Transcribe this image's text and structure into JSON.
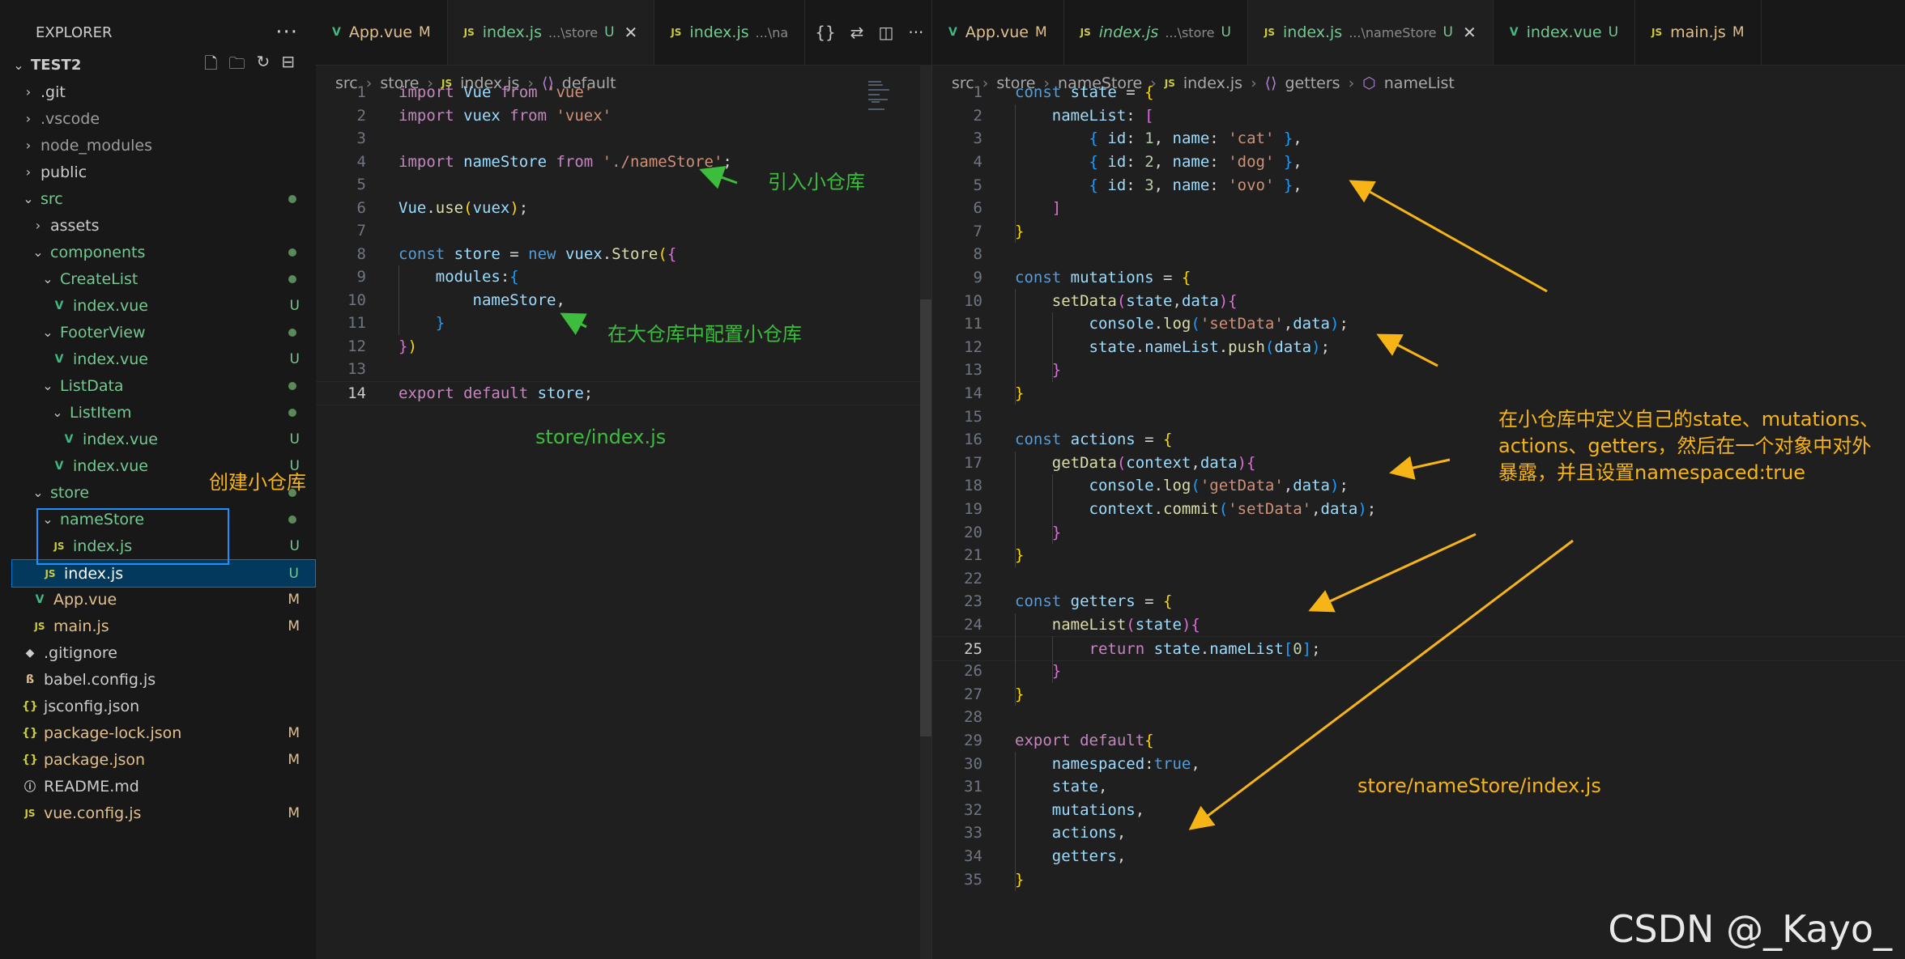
{
  "sidebar": {
    "title": "EXPLORER",
    "more": "···",
    "root": "TEST2",
    "items": [
      {
        "label": ".git",
        "kind": "folder",
        "level": 1,
        "open": false,
        "color": "#cccccc"
      },
      {
        "label": ".vscode",
        "kind": "folder",
        "level": 1,
        "open": false,
        "color": "#9d9d9d"
      },
      {
        "label": "node_modules",
        "kind": "folder",
        "level": 1,
        "open": false,
        "color": "#9d9d9d"
      },
      {
        "label": "public",
        "kind": "folder",
        "level": 1,
        "open": false,
        "color": "#cccccc"
      },
      {
        "label": "src",
        "kind": "folder",
        "level": 1,
        "open": true,
        "color": "#73c991",
        "dot": true
      },
      {
        "label": "assets",
        "kind": "folder",
        "level": 2,
        "open": false,
        "color": "#cccccc"
      },
      {
        "label": "components",
        "kind": "folder",
        "level": 2,
        "open": true,
        "color": "#73c991",
        "dot": true
      },
      {
        "label": "CreateList",
        "kind": "folder",
        "level": 3,
        "open": true,
        "color": "#73c991",
        "dot": true
      },
      {
        "label": "index.vue",
        "kind": "vue",
        "level": 4,
        "color": "#73c991",
        "status": "U"
      },
      {
        "label": "FooterView",
        "kind": "folder",
        "level": 3,
        "open": true,
        "color": "#73c991",
        "dot": true
      },
      {
        "label": "index.vue",
        "kind": "vue",
        "level": 4,
        "color": "#73c991",
        "status": "U"
      },
      {
        "label": "ListData",
        "kind": "folder",
        "level": 3,
        "open": true,
        "color": "#73c991",
        "dot": true
      },
      {
        "label": "ListItem",
        "kind": "folder",
        "level": 4,
        "open": true,
        "color": "#73c991",
        "dot": true
      },
      {
        "label": "index.vue",
        "kind": "vue",
        "level": 5,
        "color": "#73c991",
        "status": "U"
      },
      {
        "label": "index.vue",
        "kind": "vue",
        "level": 4,
        "color": "#73c991",
        "status": "U"
      },
      {
        "label": "store",
        "kind": "folder",
        "level": 2,
        "open": true,
        "color": "#73c991",
        "dot": true
      },
      {
        "label": "nameStore",
        "kind": "folder",
        "level": 3,
        "open": true,
        "color": "#73c991",
        "dot": true
      },
      {
        "label": "index.js",
        "kind": "js",
        "level": 4,
        "color": "#73c991",
        "status": "U"
      },
      {
        "label": "index.js",
        "kind": "js",
        "level": 3,
        "color": "#73c991",
        "status": "U",
        "selected": true
      },
      {
        "label": "App.vue",
        "kind": "vue",
        "level": 2,
        "color": "#e2c08d",
        "status": "M"
      },
      {
        "label": "main.js",
        "kind": "js",
        "level": 2,
        "color": "#e2c08d",
        "status": "M"
      },
      {
        "label": ".gitignore",
        "kind": "git",
        "level": 1,
        "color": "#cccccc"
      },
      {
        "label": "babel.config.js",
        "kind": "babel",
        "level": 1,
        "color": "#cccccc"
      },
      {
        "label": "jsconfig.json",
        "kind": "json",
        "level": 1,
        "color": "#cccccc"
      },
      {
        "label": "package-lock.json",
        "kind": "json",
        "level": 1,
        "color": "#e2c08d",
        "status": "M"
      },
      {
        "label": "package.json",
        "kind": "json",
        "level": 1,
        "color": "#e2c08d",
        "status": "M"
      },
      {
        "label": "README.md",
        "kind": "info",
        "level": 1,
        "color": "#cccccc"
      },
      {
        "label": "vue.config.js",
        "kind": "js",
        "level": 1,
        "color": "#e2c08d",
        "status": "M"
      }
    ]
  },
  "editor1": {
    "tabs": [
      {
        "label": "App.vue",
        "status": "M",
        "kind": "vue",
        "color": "#e2c08d"
      },
      {
        "label": "index.js",
        "desc": "...\\store",
        "status": "U",
        "kind": "js",
        "color": "#73c991",
        "active": true,
        "close": "✕"
      },
      {
        "label": "index.js",
        "desc": "...\\na",
        "kind": "js",
        "color": "#73c991"
      }
    ],
    "tools": [
      "{}",
      "⇄",
      "◫",
      "···"
    ],
    "breadcrumbs": [
      "src",
      "store",
      "index.js",
      "default"
    ],
    "current_line": 14,
    "lines": [
      [
        [
          "kw2",
          "import "
        ],
        [
          "id",
          "Vue "
        ],
        [
          "kw2",
          "from "
        ],
        [
          "str",
          "'vue'"
        ]
      ],
      [
        [
          "kw2",
          "import "
        ],
        [
          "id",
          "vuex "
        ],
        [
          "kw2",
          "from "
        ],
        [
          "str",
          "'vuex'"
        ]
      ],
      [],
      [
        [
          "kw2",
          "import "
        ],
        [
          "id",
          "nameStore "
        ],
        [
          "kw2",
          "from "
        ],
        [
          "str",
          "'./nameStore'"
        ],
        [
          "pun",
          ";"
        ]
      ],
      [],
      [
        [
          "id",
          "Vue"
        ],
        [
          "pun",
          "."
        ],
        [
          "fn",
          "use"
        ],
        [
          "br1",
          "("
        ],
        [
          "id",
          "vuex"
        ],
        [
          "br1",
          ")"
        ],
        [
          "pun",
          ";"
        ]
      ],
      [],
      [
        [
          "kw",
          "const "
        ],
        [
          "id",
          "store "
        ],
        [
          "pun",
          "= "
        ],
        [
          "kw",
          "new "
        ],
        [
          "id",
          "vuex"
        ],
        [
          "pun",
          "."
        ],
        [
          "fn",
          "Store"
        ],
        [
          "br1",
          "("
        ],
        [
          "br2",
          "{"
        ]
      ],
      [
        [
          "pun",
          "    "
        ],
        [
          "id",
          "modules"
        ],
        [
          "pun",
          ":"
        ],
        [
          "br3",
          "{"
        ]
      ],
      [
        [
          "pun",
          "        "
        ],
        [
          "id",
          "nameStore"
        ],
        [
          "pun",
          ","
        ]
      ],
      [
        [
          "pun",
          "    "
        ],
        [
          "br3",
          "}"
        ]
      ],
      [
        [
          "br2",
          "}"
        ],
        [
          "br1",
          ")"
        ]
      ],
      [],
      [
        [
          "kw2",
          "export "
        ],
        [
          "kw2",
          "default "
        ],
        [
          "id",
          "store"
        ],
        [
          "pun",
          ";"
        ]
      ]
    ],
    "annotations": [
      {
        "text": "引入小仓库",
        "color": "green"
      },
      {
        "text": "在大仓库中配置小仓库",
        "color": "green"
      },
      {
        "text": "store/index.js",
        "color": "green"
      }
    ]
  },
  "sidebar_annotation": "创建小仓库",
  "editor2": {
    "tabs": [
      {
        "label": "App.vue",
        "status": "M",
        "kind": "vue",
        "color": "#e2c08d"
      },
      {
        "label": "index.js",
        "desc": "...\\store",
        "status": "U",
        "kind": "js",
        "color": "#73c991",
        "italic": true
      },
      {
        "label": "index.js",
        "desc": "...\\nameStore",
        "status": "U",
        "kind": "js",
        "color": "#73c991",
        "active": true,
        "close": "✕"
      },
      {
        "label": "index.vue",
        "status": "U",
        "kind": "vue",
        "color": "#73c991"
      },
      {
        "label": "main.js",
        "status": "M",
        "kind": "js",
        "color": "#e2c08d"
      }
    ],
    "breadcrumbs": [
      "src",
      "store",
      "nameStore",
      "index.js",
      "getters",
      "nameList"
    ],
    "current_line": 25,
    "lines": [
      [
        [
          "kw",
          "const "
        ],
        [
          "id",
          "state "
        ],
        [
          "pun",
          "= "
        ],
        [
          "br1",
          "{"
        ]
      ],
      [
        [
          "pun",
          "    "
        ],
        [
          "id",
          "nameList"
        ],
        [
          "pun",
          ": "
        ],
        [
          "br2",
          "["
        ]
      ],
      [
        [
          "pun",
          "        "
        ],
        [
          "br3",
          "{ "
        ],
        [
          "id",
          "id"
        ],
        [
          "pun",
          ": "
        ],
        [
          "num",
          "1"
        ],
        [
          "pun",
          ", "
        ],
        [
          "id",
          "name"
        ],
        [
          "pun",
          ": "
        ],
        [
          "str",
          "'cat'"
        ],
        [
          "br3",
          " }"
        ],
        [
          "pun",
          ","
        ]
      ],
      [
        [
          "pun",
          "        "
        ],
        [
          "br3",
          "{ "
        ],
        [
          "id",
          "id"
        ],
        [
          "pun",
          ": "
        ],
        [
          "num",
          "2"
        ],
        [
          "pun",
          ", "
        ],
        [
          "id",
          "name"
        ],
        [
          "pun",
          ": "
        ],
        [
          "str",
          "'dog'"
        ],
        [
          "br3",
          " }"
        ],
        [
          "pun",
          ","
        ]
      ],
      [
        [
          "pun",
          "        "
        ],
        [
          "br3",
          "{ "
        ],
        [
          "id",
          "id"
        ],
        [
          "pun",
          ": "
        ],
        [
          "num",
          "3"
        ],
        [
          "pun",
          ", "
        ],
        [
          "id",
          "name"
        ],
        [
          "pun",
          ": "
        ],
        [
          "str",
          "'ovo'"
        ],
        [
          "br3",
          " }"
        ],
        [
          "pun",
          ","
        ]
      ],
      [
        [
          "pun",
          "    "
        ],
        [
          "br2",
          "]"
        ]
      ],
      [
        [
          "br1",
          "}"
        ]
      ],
      [],
      [
        [
          "kw",
          "const "
        ],
        [
          "id",
          "mutations "
        ],
        [
          "pun",
          "= "
        ],
        [
          "br1",
          "{"
        ]
      ],
      [
        [
          "pun",
          "    "
        ],
        [
          "fn",
          "setData"
        ],
        [
          "br2",
          "("
        ],
        [
          "id",
          "state"
        ],
        [
          "pun",
          ","
        ],
        [
          "id",
          "data"
        ],
        [
          "br2",
          ")"
        ],
        [
          "br2",
          "{"
        ]
      ],
      [
        [
          "pun",
          "        "
        ],
        [
          "id",
          "console"
        ],
        [
          "pun",
          "."
        ],
        [
          "fn",
          "log"
        ],
        [
          "br3",
          "("
        ],
        [
          "str",
          "'setData'"
        ],
        [
          "pun",
          ","
        ],
        [
          "id",
          "data"
        ],
        [
          "br3",
          ")"
        ],
        [
          "pun",
          ";"
        ]
      ],
      [
        [
          "pun",
          "        "
        ],
        [
          "id",
          "state"
        ],
        [
          "pun",
          "."
        ],
        [
          "id",
          "nameList"
        ],
        [
          "pun",
          "."
        ],
        [
          "fn",
          "push"
        ],
        [
          "br3",
          "("
        ],
        [
          "id",
          "data"
        ],
        [
          "br3",
          ")"
        ],
        [
          "pun",
          ";"
        ]
      ],
      [
        [
          "pun",
          "    "
        ],
        [
          "br2",
          "}"
        ]
      ],
      [
        [
          "br1",
          "}"
        ]
      ],
      [],
      [
        [
          "kw",
          "const "
        ],
        [
          "id",
          "actions "
        ],
        [
          "pun",
          "= "
        ],
        [
          "br1",
          "{"
        ]
      ],
      [
        [
          "pun",
          "    "
        ],
        [
          "fn",
          "getData"
        ],
        [
          "br2",
          "("
        ],
        [
          "id",
          "context"
        ],
        [
          "pun",
          ","
        ],
        [
          "id",
          "data"
        ],
        [
          "br2",
          ")"
        ],
        [
          "br2",
          "{"
        ]
      ],
      [
        [
          "pun",
          "        "
        ],
        [
          "id",
          "console"
        ],
        [
          "pun",
          "."
        ],
        [
          "fn",
          "log"
        ],
        [
          "br3",
          "("
        ],
        [
          "str",
          "'getData'"
        ],
        [
          "pun",
          ","
        ],
        [
          "id",
          "data"
        ],
        [
          "br3",
          ")"
        ],
        [
          "pun",
          ";"
        ]
      ],
      [
        [
          "pun",
          "        "
        ],
        [
          "id",
          "context"
        ],
        [
          "pun",
          "."
        ],
        [
          "fn",
          "commit"
        ],
        [
          "br3",
          "("
        ],
        [
          "str",
          "'setData'"
        ],
        [
          "pun",
          ","
        ],
        [
          "id",
          "data"
        ],
        [
          "br3",
          ")"
        ],
        [
          "pun",
          ";"
        ]
      ],
      [
        [
          "pun",
          "    "
        ],
        [
          "br2",
          "}"
        ]
      ],
      [
        [
          "br1",
          "}"
        ]
      ],
      [],
      [
        [
          "kw",
          "const "
        ],
        [
          "id",
          "getters "
        ],
        [
          "pun",
          "= "
        ],
        [
          "br1",
          "{"
        ]
      ],
      [
        [
          "pun",
          "    "
        ],
        [
          "fn",
          "nameList"
        ],
        [
          "br2",
          "("
        ],
        [
          "id",
          "state"
        ],
        [
          "br2",
          ")"
        ],
        [
          "br2",
          "{"
        ]
      ],
      [
        [
          "pun",
          "        "
        ],
        [
          "kw2",
          "return "
        ],
        [
          "id",
          "state"
        ],
        [
          "pun",
          "."
        ],
        [
          "id",
          "nameList"
        ],
        [
          "br3",
          "["
        ],
        [
          "num",
          "0"
        ],
        [
          "br3",
          "]"
        ],
        [
          "pun",
          ";"
        ]
      ],
      [
        [
          "pun",
          "    "
        ],
        [
          "br2",
          "}"
        ]
      ],
      [
        [
          "br1",
          "}"
        ]
      ],
      [],
      [
        [
          "kw2",
          "export "
        ],
        [
          "kw2",
          "default"
        ],
        [
          "br1",
          "{"
        ]
      ],
      [
        [
          "pun",
          "    "
        ],
        [
          "id",
          "namespaced"
        ],
        [
          "pun",
          ":"
        ],
        [
          "kw",
          "true"
        ],
        [
          "pun",
          ","
        ]
      ],
      [
        [
          "pun",
          "    "
        ],
        [
          "id",
          "state"
        ],
        [
          "pun",
          ","
        ]
      ],
      [
        [
          "pun",
          "    "
        ],
        [
          "id",
          "mutations"
        ],
        [
          "pun",
          ","
        ]
      ],
      [
        [
          "pun",
          "    "
        ],
        [
          "id",
          "actions"
        ],
        [
          "pun",
          ","
        ]
      ],
      [
        [
          "pun",
          "    "
        ],
        [
          "id",
          "getters"
        ],
        [
          "pun",
          ","
        ]
      ],
      [
        [
          "br1",
          "}"
        ]
      ]
    ],
    "annotations": [
      {
        "text": "在小仓库中定义自己的state、mutations、",
        "color": "orange"
      },
      {
        "text": "actions、getters，然后在一个对象中对外",
        "color": "orange"
      },
      {
        "text": "暴露，并且设置namespaced:true",
        "color": "orange"
      },
      {
        "text": "store/nameStore/index.js",
        "color": "orange"
      }
    ]
  },
  "watermark": "CSDN @_Kayo_"
}
